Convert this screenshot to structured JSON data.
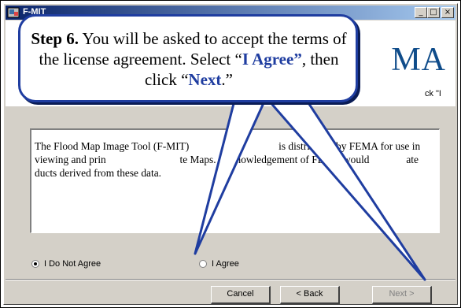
{
  "window": {
    "title": "F-MIT",
    "minimize": "_",
    "maximize": "□",
    "close": "×"
  },
  "header": {
    "logo_text": "MA",
    "subtext": "ck \"I"
  },
  "license": {
    "text": "The Flood Map Image Tool (F-MIT)                                  is distributed by FEMA for use in viewing and prin                            te Maps. Acknowledgement of FEMA would              ate            ducts derived from these data."
  },
  "options": {
    "disagree": {
      "label": "I Do Not Agree",
      "checked": true
    },
    "agree": {
      "label": "I Agree",
      "checked": false
    }
  },
  "buttons": {
    "cancel": "Cancel",
    "back": "< Back",
    "next": "Next >"
  },
  "callout": {
    "step": "Step 6.",
    "text1": " You will be asked to accept the terms of the license agreement.  Select “",
    "agree_word": "I Agree”",
    "text2": ", then click “",
    "next_word": "Next",
    "text3": ".”"
  },
  "colors": {
    "callout_border": "#1f3da0",
    "titlebar": "#0a246a",
    "logo": "#0f4c8a"
  }
}
